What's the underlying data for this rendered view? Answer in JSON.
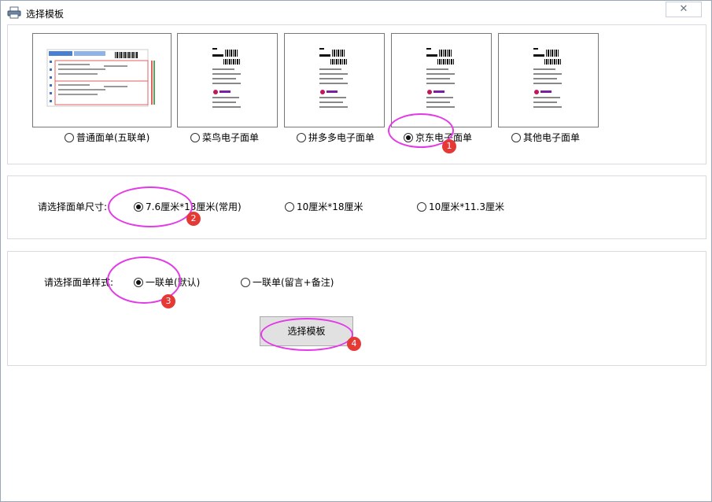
{
  "window": {
    "title": "选择模板",
    "close_glyph": "✕"
  },
  "templates": {
    "options": [
      {
        "label": "普通面单(五联单)",
        "selected": false
      },
      {
        "label": "菜鸟电子面单",
        "selected": false
      },
      {
        "label": "拼多多电子面单",
        "selected": false
      },
      {
        "label": "京东电子面单",
        "selected": true
      },
      {
        "label": "其他电子面单",
        "selected": false
      }
    ]
  },
  "size": {
    "label": "请选择面单尺寸:",
    "options": [
      {
        "label": "7.6厘米*13厘米(常用)",
        "selected": true
      },
      {
        "label": "10厘米*18厘米",
        "selected": false
      },
      {
        "label": "10厘米*11.3厘米",
        "selected": false
      }
    ]
  },
  "style": {
    "label": "请选择面单样式:",
    "options": [
      {
        "label": "一联单(默认)",
        "selected": true
      },
      {
        "label": "一联单(留言+备注)",
        "selected": false
      }
    ],
    "button_label": "选择模板"
  },
  "annotations": {
    "badges": [
      "1",
      "2",
      "3",
      "4"
    ],
    "color": "#e33ae8",
    "badge_color": "#e53935"
  },
  "icons": {
    "window": "printer-icon",
    "close": "close-icon"
  }
}
